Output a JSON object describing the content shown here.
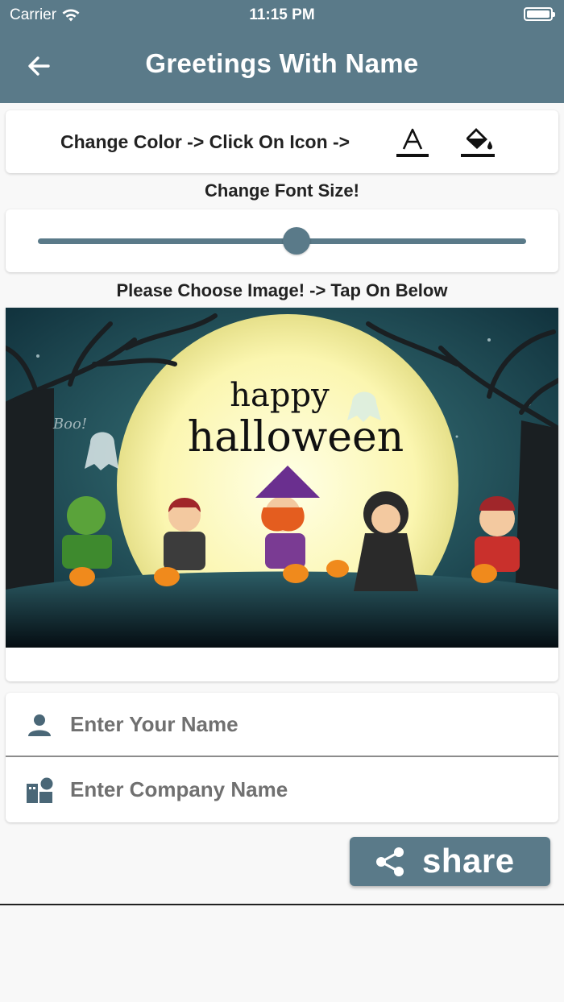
{
  "status_bar": {
    "carrier": "Carrier",
    "time": "11:15 PM"
  },
  "header": {
    "title": "Greetings With Name",
    "back_icon": "arrow-left-icon"
  },
  "color_section": {
    "label": "Change Color -> Click On Icon ->",
    "text_color_icon": "text-color-icon",
    "fill_color_icon": "fill-color-icon",
    "accent": "#5a7a89"
  },
  "font_size": {
    "label": "Change Font Size!",
    "slider_value": 0.53
  },
  "image_section": {
    "label": "Please Choose Image! -> Tap On Below",
    "image_text_line1": "happy",
    "image_text_line2": "halloween",
    "image_boo": "Boo!"
  },
  "inputs": {
    "name_placeholder": "Enter Your Name",
    "company_placeholder": "Enter Company Name",
    "name_icon": "person-icon",
    "company_icon": "business-icon"
  },
  "share": {
    "label": "share",
    "icon": "share-icon"
  }
}
